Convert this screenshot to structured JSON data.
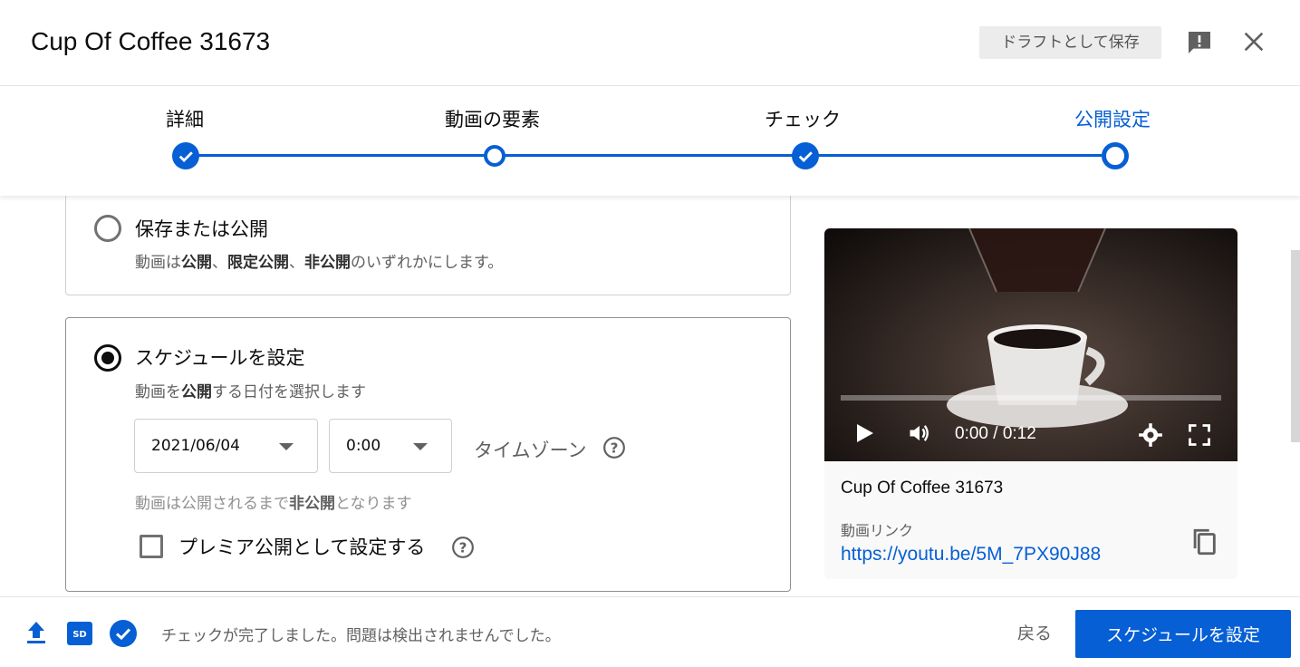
{
  "header": {
    "title": "Cup Of Coffee 31673",
    "draft_label": "ドラフトとして保存"
  },
  "stepper": {
    "steps": [
      {
        "label": "詳細",
        "state": "done"
      },
      {
        "label": "動画の要素",
        "state": "visited"
      },
      {
        "label": "チェック",
        "state": "done"
      },
      {
        "label": "公開設定",
        "state": "active"
      }
    ]
  },
  "options": {
    "save_or_publish": {
      "title": "保存または公開",
      "desc_parts": [
        "動画は",
        "公開",
        "、",
        "限定公開",
        "、",
        "非公開",
        "のいずれかにします。"
      ],
      "selected": false
    },
    "schedule": {
      "title": "スケジュールを設定",
      "desc_parts": [
        "動画を",
        "公開",
        "する日付を選択します"
      ],
      "selected": true,
      "date": "2021/06/04",
      "time": "0:00",
      "timezone_label": "タイムゾーン",
      "note_parts": [
        "動画は公開されるまで",
        "非公開",
        "となります"
      ],
      "premiere_label": "プレミア公開として設定する",
      "premiere_checked": false
    }
  },
  "preview": {
    "time_display": "0:00 / 0:12",
    "video_title": "Cup Of Coffee 31673",
    "link_label": "動画リンク",
    "link_url": "https://youtu.be/5M_7PX90J88"
  },
  "footer": {
    "status": "チェックが完了しました。問題は検出されませんでした。",
    "back_label": "戻る",
    "primary_label": "スケジュールを設定"
  },
  "colors": {
    "accent": "#065fd4",
    "text": "#0d0d0d",
    "secondary": "#606060"
  }
}
